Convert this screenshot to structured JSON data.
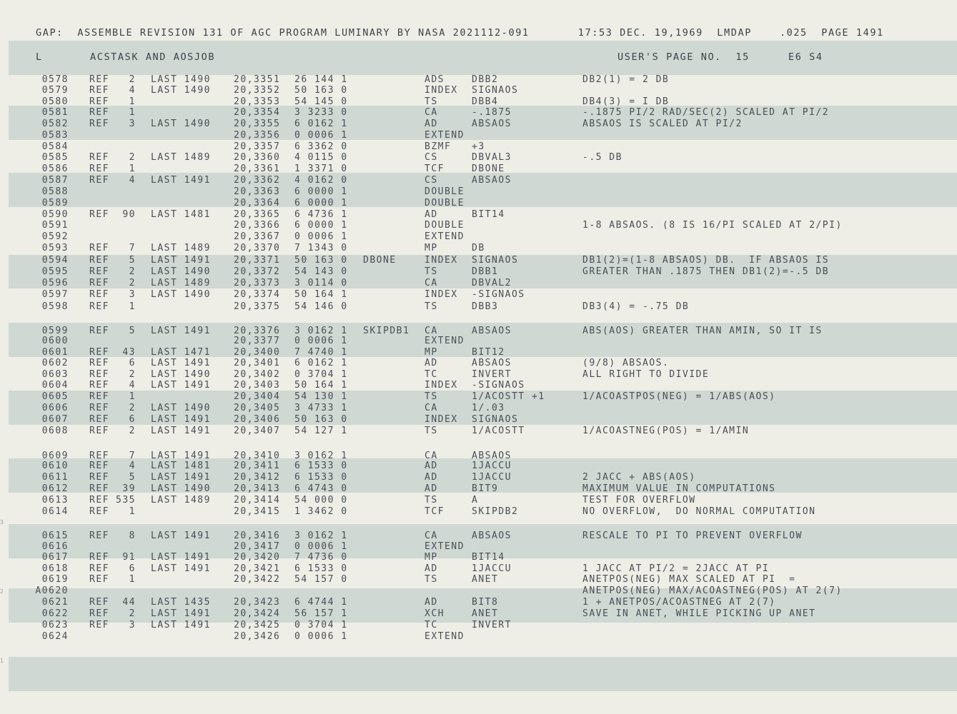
{
  "header": {
    "title_line": "GAP:  ASSEMBLE REVISION 131 OF AGC PROGRAM LUMINARY BY NASA 2021112-091       17:53 DEC. 19,1969  LMDAP    .025  PAGE 1491",
    "section_marker": "L",
    "section_title": "ACSTASK AND AOSJOB",
    "users_page": "USER'S PAGE NO.  15",
    "page_code": "E6 S4"
  },
  "rows": [
    {
      "loc": "0578",
      "ref": "REF",
      "cnt": "2",
      "last": "LAST 1490",
      "addr": "20,3351",
      "oct": "26 144 1",
      "lab": "",
      "op": "ADS",
      "opd": "DBB2",
      "cmt": "DB2(1) = 2 DB"
    },
    {
      "loc": "0579",
      "ref": "REF",
      "cnt": "4",
      "last": "LAST 1490",
      "addr": "20,3352",
      "oct": "50 163 0",
      "lab": "",
      "op": "INDEX",
      "opd": "SIGNAOS",
      "cmt": ""
    },
    {
      "loc": "0580",
      "ref": "REF",
      "cnt": "1",
      "last": "",
      "addr": "20,3353",
      "oct": "54 145 0",
      "lab": "",
      "op": "TS",
      "opd": "DBB4",
      "cmt": "DB4(3) = I DB"
    },
    {
      "loc": "0581",
      "ref": "REF",
      "cnt": "1",
      "last": "",
      "addr": "20,3354",
      "oct": "3 3233 0",
      "lab": "",
      "op": "CA",
      "opd": "-.1875",
      "cmt": "-.1875 PI/2 RAD/SEC(2) SCALED AT PI/2"
    },
    {
      "loc": "0582",
      "ref": "REF",
      "cnt": "3",
      "last": "LAST 1490",
      "addr": "20,3355",
      "oct": "6 0162 1",
      "lab": "",
      "op": "AD",
      "opd": "ABSAOS",
      "cmt": "ABSAOS IS SCALED AT PI/2"
    },
    {
      "loc": "0583",
      "ref": "",
      "cnt": "",
      "last": "",
      "addr": "20,3356",
      "oct": "0 0006 1",
      "lab": "",
      "op": "EXTEND",
      "opd": "",
      "cmt": ""
    },
    {
      "loc": "0584",
      "ref": "",
      "cnt": "",
      "last": "",
      "addr": "20,3357",
      "oct": "6 3362 0",
      "lab": "",
      "op": "BZMF",
      "opd": "+3",
      "cmt": ""
    },
    {
      "loc": "0585",
      "ref": "REF",
      "cnt": "2",
      "last": "LAST 1489",
      "addr": "20,3360",
      "oct": "4 0115 0",
      "lab": "",
      "op": "CS",
      "opd": "DBVAL3",
      "cmt": "-.5 DB"
    },
    {
      "loc": "0586",
      "ref": "REF",
      "cnt": "1",
      "last": "",
      "addr": "20,3361",
      "oct": "1 3371 0",
      "lab": "",
      "op": "TCF",
      "opd": "DBONE",
      "cmt": ""
    },
    {
      "loc": "0587",
      "ref": "REF",
      "cnt": "4",
      "last": "LAST 1491",
      "addr": "20,3362",
      "oct": "4 0162 0",
      "lab": "",
      "op": "CS",
      "opd": "ABSAOS",
      "cmt": ""
    },
    {
      "loc": "0588",
      "ref": "",
      "cnt": "",
      "last": "",
      "addr": "20,3363",
      "oct": "6 0000 1",
      "lab": "",
      "op": "DOUBLE",
      "opd": "",
      "cmt": ""
    },
    {
      "loc": "0589",
      "ref": "",
      "cnt": "",
      "last": "",
      "addr": "20,3364",
      "oct": "6 0000 1",
      "lab": "",
      "op": "DOUBLE",
      "opd": "",
      "cmt": ""
    },
    {
      "loc": "0590",
      "ref": "REF",
      "cnt": "90",
      "last": "LAST 1481",
      "addr": "20,3365",
      "oct": "6 4736 1",
      "lab": "",
      "op": "AD",
      "opd": "BIT14",
      "cmt": ""
    },
    {
      "loc": "0591",
      "ref": "",
      "cnt": "",
      "last": "",
      "addr": "20,3366",
      "oct": "6 0000 1",
      "lab": "",
      "op": "DOUBLE",
      "opd": "",
      "cmt": "1-8 ABSAOS. (8 IS 16/PI SCALED AT 2/PI)"
    },
    {
      "loc": "0592",
      "ref": "",
      "cnt": "",
      "last": "",
      "addr": "20,3367",
      "oct": "0 0006 1",
      "lab": "",
      "op": "EXTEND",
      "opd": "",
      "cmt": ""
    },
    {
      "loc": "0593",
      "ref": "REF",
      "cnt": "7",
      "last": "LAST 1489",
      "addr": "20,3370",
      "oct": "7 1343 0",
      "lab": "",
      "op": "MP",
      "opd": "DB",
      "cmt": ""
    },
    {
      "loc": "0594",
      "ref": "REF",
      "cnt": "5",
      "last": "LAST 1491",
      "addr": "20,3371",
      "oct": "50 163 0",
      "lab": "DBONE",
      "op": "INDEX",
      "opd": "SIGNAOS",
      "cmt": "DB1(2)=(1-8 ABSAOS) DB.  IF ABSAOS IS"
    },
    {
      "loc": "0595",
      "ref": "REF",
      "cnt": "2",
      "last": "LAST 1490",
      "addr": "20,3372",
      "oct": "54 143 0",
      "lab": "",
      "op": "TS",
      "opd": "DBB1",
      "cmt": "GREATER THAN .1875 THEN DB1(2)=-.5 DB"
    },
    {
      "loc": "0596",
      "ref": "REF",
      "cnt": "2",
      "last": "LAST 1489",
      "addr": "20,3373",
      "oct": "3 0114 0",
      "lab": "",
      "op": "CA",
      "opd": "DBVAL2",
      "cmt": ""
    },
    {
      "loc": "0597",
      "ref": "REF",
      "cnt": "3",
      "last": "LAST 1490",
      "addr": "20,3374",
      "oct": "50 164 1",
      "lab": "",
      "op": "INDEX",
      "opd": "-SIGNAOS",
      "cmt": ""
    },
    {
      "loc": "0598",
      "ref": "REF",
      "cnt": "1",
      "last": "",
      "addr": "20,3375",
      "oct": "54 146 0",
      "lab": "",
      "op": "TS",
      "opd": "DBB3",
      "cmt": "DB3(4) = -.75 DB"
    },
    {
      "loc": "0599",
      "ref": "REF",
      "cnt": "5",
      "last": "LAST 1491",
      "addr": "20,3376",
      "oct": "3 0162 1",
      "lab": "SKIPDB1",
      "op": "CA",
      "opd": "ABSAOS",
      "cmt": "ABS(AOS) GREATER THAN AMIN, SO IT IS"
    },
    {
      "loc": "0600",
      "ref": "",
      "cnt": "",
      "last": "",
      "addr": "20,3377",
      "oct": "0 0006 1",
      "lab": "",
      "op": "EXTEND",
      "opd": "",
      "cmt": ""
    },
    {
      "loc": "0601",
      "ref": "REF",
      "cnt": "43",
      "last": "LAST 1471",
      "addr": "20,3400",
      "oct": "7 4740 1",
      "lab": "",
      "op": "MP",
      "opd": "BIT12",
      "cmt": ""
    },
    {
      "loc": "0602",
      "ref": "REF",
      "cnt": "6",
      "last": "LAST 1491",
      "addr": "20,3401",
      "oct": "6 0162 1",
      "lab": "",
      "op": "AD",
      "opd": "ABSAOS",
      "cmt": "(9/8) ABSAOS."
    },
    {
      "loc": "0603",
      "ref": "REF",
      "cnt": "2",
      "last": "LAST 1490",
      "addr": "20,3402",
      "oct": "0 3704 1",
      "lab": "",
      "op": "TC",
      "opd": "INVERT",
      "cmt": "ALL RIGHT TO DIVIDE"
    },
    {
      "loc": "0604",
      "ref": "REF",
      "cnt": "4",
      "last": "LAST 1491",
      "addr": "20,3403",
      "oct": "50 164 1",
      "lab": "",
      "op": "INDEX",
      "opd": "-SIGNAOS",
      "cmt": ""
    },
    {
      "loc": "0605",
      "ref": "REF",
      "cnt": "1",
      "last": "",
      "addr": "20,3404",
      "oct": "54 130 1",
      "lab": "",
      "op": "TS",
      "opd": "1/ACOSTT +1",
      "cmt": "1/ACOASTPOS(NEG) = 1/ABS(AOS)"
    },
    {
      "loc": "0606",
      "ref": "REF",
      "cnt": "2",
      "last": "LAST 1490",
      "addr": "20,3405",
      "oct": "3 4733 1",
      "lab": "",
      "op": "CA",
      "opd": "1/.03",
      "cmt": ""
    },
    {
      "loc": "0607",
      "ref": "REF",
      "cnt": "6",
      "last": "LAST 1491",
      "addr": "20,3406",
      "oct": "50 163 0",
      "lab": "",
      "op": "INDEX",
      "opd": "SIGNAOS",
      "cmt": ""
    },
    {
      "loc": "0608",
      "ref": "REF",
      "cnt": "2",
      "last": "LAST 1491",
      "addr": "20,3407",
      "oct": "54 127 1",
      "lab": "",
      "op": "TS",
      "opd": "1/ACOSTT",
      "cmt": "1/ACOASTNEG(POS) = 1/AMIN"
    },
    {
      "loc": "0609",
      "ref": "REF",
      "cnt": "7",
      "last": "LAST 1491",
      "addr": "20,3410",
      "oct": "3 0162 1",
      "lab": "",
      "op": "CA",
      "opd": "ABSAOS",
      "cmt": ""
    },
    {
      "loc": "0610",
      "ref": "REF",
      "cnt": "4",
      "last": "LAST 1481",
      "addr": "20,3411",
      "oct": "6 1533 0",
      "lab": "",
      "op": "AD",
      "opd": "1JACCU",
      "cmt": ""
    },
    {
      "loc": "0611",
      "ref": "REF",
      "cnt": "5",
      "last": "LAST 1491",
      "addr": "20,3412",
      "oct": "6 1533 0",
      "lab": "",
      "op": "AD",
      "opd": "1JACCU",
      "cmt": "2 JACC + ABS(AOS)"
    },
    {
      "loc": "0612",
      "ref": "REF",
      "cnt": "39",
      "last": "LAST 1490",
      "addr": "20,3413",
      "oct": "6 4743 0",
      "lab": "",
      "op": "AD",
      "opd": "BIT9",
      "cmt": "MAXIMUM VALUE IN COMPUTATIONS"
    },
    {
      "loc": "0613",
      "ref": "REF",
      "cnt": "535",
      "last": "LAST 1489",
      "addr": "20,3414",
      "oct": "54 000 0",
      "lab": "",
      "op": "TS",
      "opd": "A",
      "cmt": "TEST FOR OVERFLOW"
    },
    {
      "loc": "0614",
      "ref": "REF",
      "cnt": "1",
      "last": "",
      "addr": "20,3415",
      "oct": "1 3462 0",
      "lab": "",
      "op": "TCF",
      "opd": "SKIPDB2",
      "cmt": "NO OVERFLOW,  DO NORMAL COMPUTATION"
    },
    {
      "loc": "0615",
      "ref": "REF",
      "cnt": "8",
      "last": "LAST 1491",
      "addr": "20,3416",
      "oct": "3 0162 1",
      "lab": "",
      "op": "CA",
      "opd": "ABSAOS",
      "cmt": "RESCALE TO PI TO PREVENT OVERFLOW"
    },
    {
      "loc": "0616",
      "ref": "",
      "cnt": "",
      "last": "",
      "addr": "20,3417",
      "oct": "0 0006 1",
      "lab": "",
      "op": "EXTEND",
      "opd": "",
      "cmt": ""
    },
    {
      "loc": "0617",
      "ref": "REF",
      "cnt": "91",
      "last": "LAST 1491",
      "addr": "20,3420",
      "oct": "7 4736 0",
      "lab": "",
      "op": "MP",
      "opd": "BIT14",
      "cmt": ""
    },
    {
      "loc": "0618",
      "ref": "REF",
      "cnt": "6",
      "last": "LAST 1491",
      "addr": "20,3421",
      "oct": "6 1533 0",
      "lab": "",
      "op": "AD",
      "opd": "1JACCU",
      "cmt": "1 JACC AT PI/2 = 2JACC AT PI"
    },
    {
      "loc": "0619",
      "ref": "REF",
      "cnt": "1",
      "last": "",
      "addr": "20,3422",
      "oct": "54 157 0",
      "lab": "",
      "op": "TS",
      "opd": "ANET",
      "cmt": "ANETPOS(NEG) MAX SCALED AT PI  ="
    },
    {
      "loc": "A0620",
      "ref": "",
      "cnt": "",
      "last": "",
      "addr": "",
      "oct": "",
      "lab": "",
      "op": "",
      "opd": "",
      "cmt": "ANETPOS(NEG) MAX/ACOASTNEG(POS) AT 2(7)"
    },
    {
      "loc": "0621",
      "ref": "REF",
      "cnt": "44",
      "last": "LAST 1435",
      "addr": "20,3423",
      "oct": "6 4744 1",
      "lab": "",
      "op": "AD",
      "opd": "BIT8",
      "cmt": "1 + ANETPOS/ACOASTNEG AT 2(7)"
    },
    {
      "loc": "0622",
      "ref": "REF",
      "cnt": "2",
      "last": "LAST 1491",
      "addr": "20,3424",
      "oct": "56 157 1",
      "lab": "",
      "op": "XCH",
      "opd": "ANET",
      "cmt": "SAVE IN ANET, WHILE PICKING UP ANET"
    },
    {
      "loc": "0623",
      "ref": "REF",
      "cnt": "3",
      "last": "LAST 1491",
      "addr": "20,3425",
      "oct": "0 3704 1",
      "lab": "",
      "op": "TC",
      "opd": "INVERT",
      "cmt": ""
    },
    {
      "loc": "0624",
      "ref": "",
      "cnt": "",
      "last": "",
      "addr": "20,3426",
      "oct": "0 0006 1",
      "lab": "",
      "op": "EXTEND",
      "opd": "",
      "cmt": ""
    }
  ],
  "colors": {
    "paper": "#eeeee6",
    "band": "#cfd8d2",
    "ink": "#4a4e56"
  }
}
